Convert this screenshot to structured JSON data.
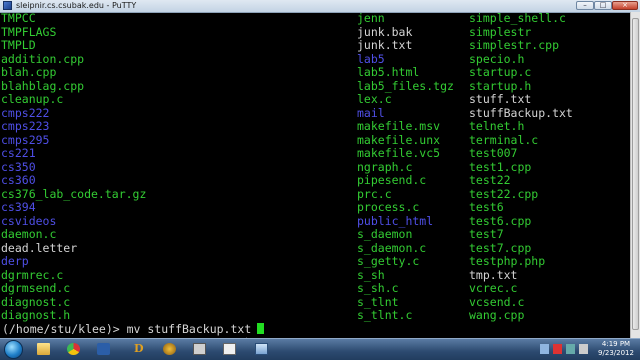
{
  "window": {
    "title": "sleipnir.cs.csubak.edu - PuTTY",
    "minimize_label": "–",
    "maximize_label": "□",
    "close_label": "×"
  },
  "terminal": {
    "colors": {
      "green": "#33cc33",
      "white": "#d4d4d4",
      "blue": "#4f4fe6",
      "background": "#000000"
    },
    "columns": [
      [
        {
          "name": "TMPCC",
          "color": "green"
        },
        {
          "name": "TMPFLAGS",
          "color": "green"
        },
        {
          "name": "TMPLD",
          "color": "green"
        },
        {
          "name": "addition.cpp",
          "color": "green"
        },
        {
          "name": "blah.cpp",
          "color": "green"
        },
        {
          "name": "blahblag.cpp",
          "color": "green"
        },
        {
          "name": "cleanup.c",
          "color": "green"
        },
        {
          "name": "cmps222",
          "color": "blue"
        },
        {
          "name": "cmps223",
          "color": "blue"
        },
        {
          "name": "cmps295",
          "color": "blue"
        },
        {
          "name": "cs221",
          "color": "blue"
        },
        {
          "name": "cs350",
          "color": "blue"
        },
        {
          "name": "cs360",
          "color": "blue"
        },
        {
          "name": "cs376_lab_code.tar.gz",
          "color": "green"
        },
        {
          "name": "cs394",
          "color": "blue"
        },
        {
          "name": "csvideos",
          "color": "blue"
        },
        {
          "name": "daemon.c",
          "color": "green"
        },
        {
          "name": "dead.letter",
          "color": "white"
        },
        {
          "name": "derp",
          "color": "blue"
        },
        {
          "name": "dgrmrec.c",
          "color": "green"
        },
        {
          "name": "dgrmsend.c",
          "color": "green"
        },
        {
          "name": "diagnost.c",
          "color": "green"
        },
        {
          "name": "diagnost.h",
          "color": "green"
        }
      ],
      [
        {
          "name": "jenn",
          "color": "green"
        },
        {
          "name": "junk.bak",
          "color": "white"
        },
        {
          "name": "junk.txt",
          "color": "white"
        },
        {
          "name": "lab5",
          "color": "blue"
        },
        {
          "name": "lab5.html",
          "color": "green"
        },
        {
          "name": "lab5_files.tgz",
          "color": "green"
        },
        {
          "name": "lex.c",
          "color": "green"
        },
        {
          "name": "mail",
          "color": "blue"
        },
        {
          "name": "makefile.msv",
          "color": "green"
        },
        {
          "name": "makefile.unx",
          "color": "green"
        },
        {
          "name": "makefile.vc5",
          "color": "green"
        },
        {
          "name": "ngraph.c",
          "color": "green"
        },
        {
          "name": "pipesend.c",
          "color": "green"
        },
        {
          "name": "prc.c",
          "color": "green"
        },
        {
          "name": "process.c",
          "color": "green"
        },
        {
          "name": "public_html",
          "color": "blue"
        },
        {
          "name": "s_daemon",
          "color": "green"
        },
        {
          "name": "s_daemon.c",
          "color": "green"
        },
        {
          "name": "s_getty.c",
          "color": "green"
        },
        {
          "name": "s_sh",
          "color": "green"
        },
        {
          "name": "s_sh.c",
          "color": "green"
        },
        {
          "name": "s_tlnt",
          "color": "green"
        },
        {
          "name": "s_tlnt.c",
          "color": "green"
        }
      ],
      [
        {
          "name": "simple_shell.c",
          "color": "green"
        },
        {
          "name": "simplestr",
          "color": "green"
        },
        {
          "name": "simplestr.cpp",
          "color": "green"
        },
        {
          "name": "specio.h",
          "color": "green"
        },
        {
          "name": "startup.c",
          "color": "green"
        },
        {
          "name": "startup.h",
          "color": "green"
        },
        {
          "name": "stuff.txt",
          "color": "white"
        },
        {
          "name": "stuffBackup.txt",
          "color": "white"
        },
        {
          "name": "telnet.h",
          "color": "green"
        },
        {
          "name": "terminal.c",
          "color": "green"
        },
        {
          "name": "test007",
          "color": "green"
        },
        {
          "name": "test1.cpp",
          "color": "green"
        },
        {
          "name": "test22",
          "color": "green"
        },
        {
          "name": "test22.cpp",
          "color": "green"
        },
        {
          "name": "test6",
          "color": "green"
        },
        {
          "name": "test6.cpp",
          "color": "green"
        },
        {
          "name": "test7",
          "color": "green"
        },
        {
          "name": "test7.cpp",
          "color": "green"
        },
        {
          "name": "testphp.php",
          "color": "green"
        },
        {
          "name": "tmp.txt",
          "color": "white"
        },
        {
          "name": "vcrec.c",
          "color": "green"
        },
        {
          "name": "vcsend.c",
          "color": "green"
        },
        {
          "name": "wang.cpp",
          "color": "green"
        }
      ]
    ],
    "prompt": "(/home/stu/klee)> mv stuffBackup.txt"
  },
  "taskbar": {
    "items": [
      {
        "icon": "windows-explorer-icon",
        "active": false
      },
      {
        "icon": "chrome-icon",
        "active": false
      },
      {
        "icon": "media-player-icon",
        "active": false
      },
      {
        "icon": "diablo-icon",
        "active": false
      },
      {
        "icon": "world-of-warcraft-icon",
        "active": false
      },
      {
        "icon": "putty-icon",
        "active": false
      },
      {
        "icon": "window-icon",
        "active": false
      },
      {
        "icon": "network-icon",
        "active": true
      }
    ],
    "diablo_glyph": "D",
    "clock_time": "4:19 PM",
    "clock_date": "9/23/2012"
  }
}
